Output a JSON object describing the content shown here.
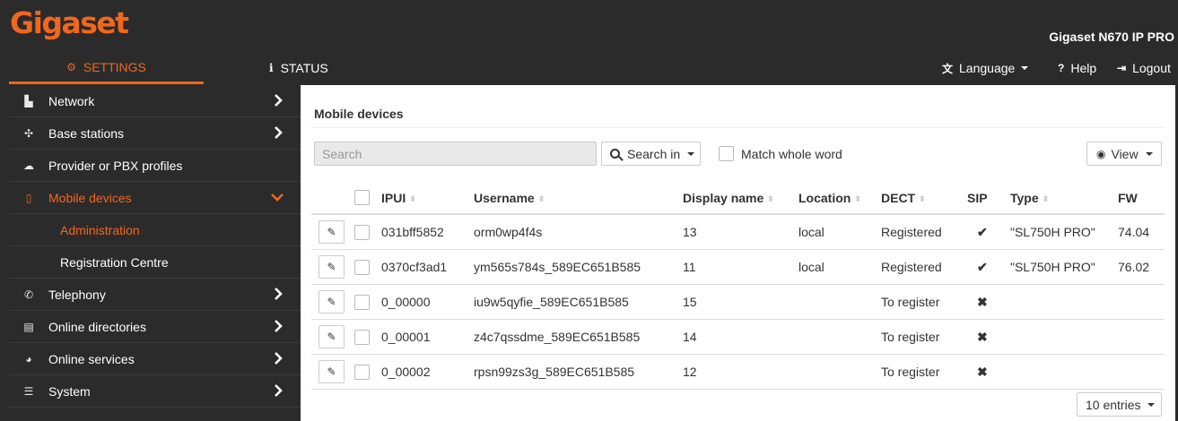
{
  "header": {
    "logo_text": "Gigaset",
    "device_name": "Gigaset N670 IP PRO",
    "accent_color": "#f0671e"
  },
  "nav": {
    "tabs": [
      {
        "label": "SETTINGS",
        "icon": "gears-icon",
        "active": true
      },
      {
        "label": "STATUS",
        "icon": "info-icon",
        "active": false
      }
    ],
    "language_label": "Language",
    "help_label": "Help",
    "logout_label": "Logout"
  },
  "sidebar": {
    "items": [
      {
        "label": "Network",
        "icon": "sitemap-icon"
      },
      {
        "label": "Base stations",
        "icon": "base-stations-icon"
      },
      {
        "label": "Provider or PBX profiles",
        "icon": "cloud-icon"
      },
      {
        "label": "Mobile devices",
        "icon": "mobile-icon",
        "active": true,
        "expanded": true
      },
      {
        "label": "Telephony",
        "icon": "phone-icon"
      },
      {
        "label": "Online directories",
        "icon": "book-icon"
      },
      {
        "label": "Online services",
        "icon": "globe-icon"
      },
      {
        "label": "System",
        "icon": "sliders-icon"
      }
    ],
    "subitems": [
      {
        "label": "Administration",
        "active": true
      },
      {
        "label": "Registration Centre",
        "active": false
      }
    ]
  },
  "main": {
    "title": "Mobile devices",
    "search_placeholder": "Search",
    "search_in_label": "Search in",
    "match_whole_word_label": "Match whole word",
    "view_label": "View",
    "entries_label": "10 entries",
    "columns": [
      "IPUI",
      "Username",
      "Display name",
      "Location",
      "DECT",
      "SIP",
      "Type",
      "FW"
    ],
    "rows": [
      {
        "ipui": "031bff5852",
        "username": "orm0wp4f4s",
        "display_name": "13",
        "location": "local",
        "dect": "Registered",
        "sip": "✔",
        "type": "\"SL750H PRO\"",
        "fw": "74.04"
      },
      {
        "ipui": "0370cf3ad1",
        "username": "ym565s784s_589EC651B585",
        "display_name": "11",
        "location": "local",
        "dect": "Registered",
        "sip": "✔",
        "type": "\"SL750H PRO\"",
        "fw": "76.02"
      },
      {
        "ipui": "0_00000",
        "username": "iu9w5qyfie_589EC651B585",
        "display_name": "15",
        "location": "",
        "dect": "To register",
        "sip": "✖",
        "type": "",
        "fw": ""
      },
      {
        "ipui": "0_00001",
        "username": "z4c7qssdme_589EC651B585",
        "display_name": "14",
        "location": "",
        "dect": "To register",
        "sip": "✖",
        "type": "",
        "fw": ""
      },
      {
        "ipui": "0_00002",
        "username": "rpsn99zs3g_589EC651B585",
        "display_name": "12",
        "location": "",
        "dect": "To register",
        "sip": "✖",
        "type": "",
        "fw": ""
      }
    ]
  }
}
